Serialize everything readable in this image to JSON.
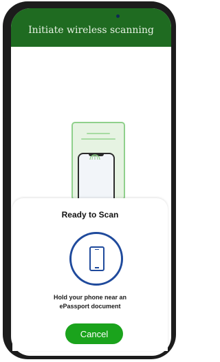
{
  "header": {
    "title": "Initiate wireless scanning"
  },
  "sheet": {
    "title": "Ready to Scan",
    "instruction_line1": "Hold your phone near an",
    "instruction_line2": "ePassport document",
    "cancel_label": "Cancel"
  },
  "icons": {
    "illustration": "passport-with-phone-illustration",
    "scan_icon": "phone-icon"
  },
  "colors": {
    "header_bg": "#1f6b21",
    "accent_blue": "#1f4a9c",
    "cancel_green": "#1aa31c"
  }
}
